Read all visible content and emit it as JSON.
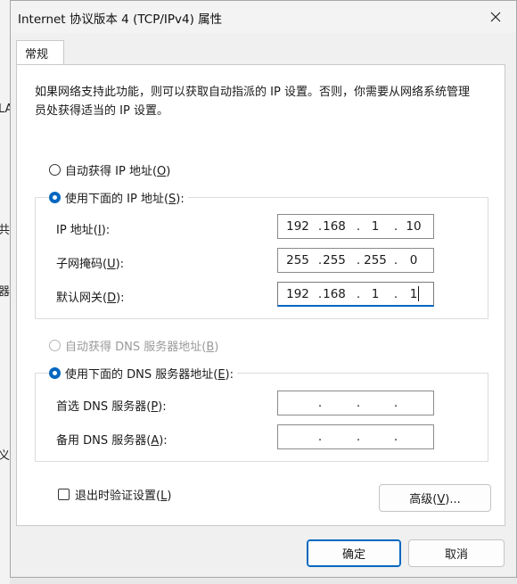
{
  "background": {
    "frag_texts": [
      "LA",
      "共",
      "器",
      "义"
    ]
  },
  "dialog": {
    "title": "Internet 协议版本 4 (TCP/IPv4) 属性",
    "tab": "常规",
    "description": "如果网络支持此功能，则可以获取自动指派的 IP 设置。否则，你需要从网络系统管理员处获得适当的 IP 设置。",
    "ip_auto": {
      "text": "自动获得 IP 地址(",
      "key": "O",
      "end": ")"
    },
    "ip_manual": {
      "text": "使用下面的 IP 地址(",
      "key": "S",
      "end": "):"
    },
    "ip_fields": [
      {
        "label": "IP 地址(",
        "key": "I",
        "end": "):",
        "octets": [
          "192",
          "168",
          "1",
          "10"
        ]
      },
      {
        "label": "子网掩码(",
        "key": "U",
        "end": "):",
        "octets": [
          "255",
          "255",
          "255",
          "0"
        ]
      },
      {
        "label": "默认网关(",
        "key": "D",
        "end": "):",
        "octets": [
          "192",
          "168",
          "1",
          "1"
        ]
      }
    ],
    "dns_auto": {
      "text": "自动获得 DNS 服务器地址(",
      "key": "B",
      "end": ")"
    },
    "dns_manual": {
      "text": "使用下面的 DNS 服务器地址(",
      "key": "E",
      "end": "):"
    },
    "dns_fields": [
      {
        "label": "首选 DNS 服务器(",
        "key": "P",
        "end": "):",
        "octets": [
          "",
          "",
          "",
          ""
        ]
      },
      {
        "label": "备用 DNS 服务器(",
        "key": "A",
        "end": "):",
        "octets": [
          "",
          "",
          "",
          ""
        ]
      }
    ],
    "validate": {
      "text": "退出时验证设置(",
      "key": "L",
      "end": ")"
    },
    "advanced": {
      "text": "高级(",
      "key": "V",
      "end": ")..."
    },
    "ok": "确定",
    "cancel": "取消",
    "dot": "."
  }
}
